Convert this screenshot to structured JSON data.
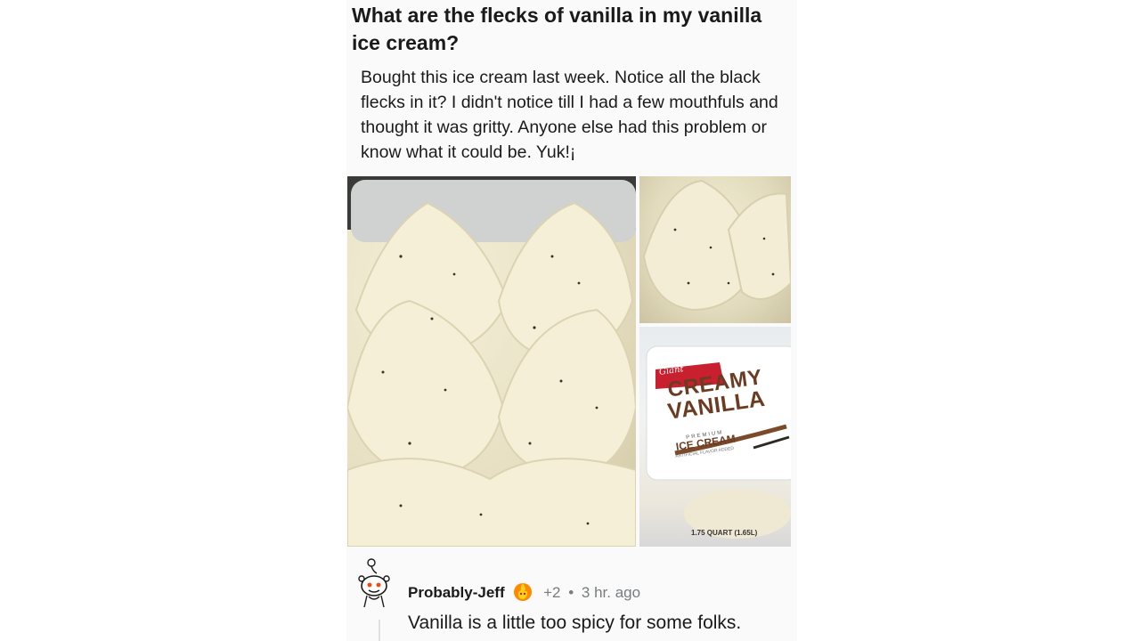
{
  "post": {
    "title": "What are the flecks of vanilla in my vanilla ice cream?",
    "body": "Bought this ice cream last week. Notice all the black flecks in it?  I didn't notice till I had a few mouthfuls and thought it was gritty. Anyone else had this problem or know what it could be. Yuk!¡"
  },
  "package": {
    "brand": "Giant",
    "line1": "CREAMY",
    "line2": "VANILLA",
    "premium": "PREMIUM",
    "product": "ICE CREAM",
    "flavor_note": "ARTIFICIAL FLAVOR ADDED",
    "size": "1.75 QUART (1.65L)"
  },
  "comment": {
    "author": "Probably-Jeff",
    "score": "+2",
    "separator": "•",
    "time": "3 hr. ago",
    "text": "Vanilla is a little too spicy for some folks."
  },
  "colors": {
    "brand_red": "#c8202f",
    "vanilla_brown": "#6b3b22",
    "meta_gray": "#787c7e"
  }
}
